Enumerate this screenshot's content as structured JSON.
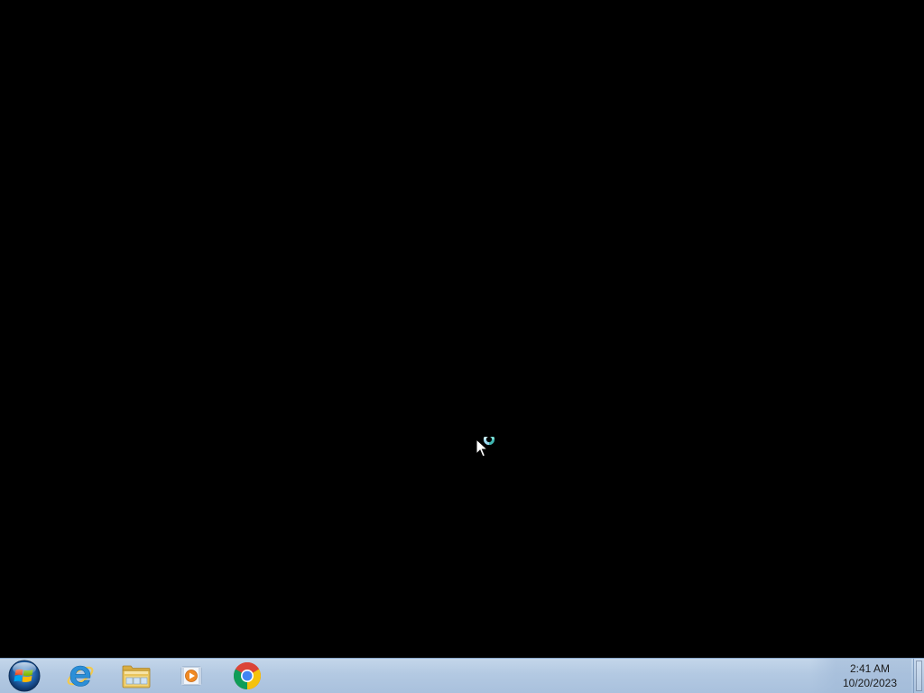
{
  "desktop": {
    "background": "#000000",
    "cursor_state": "busy-pointer"
  },
  "taskbar": {
    "background": "#b3c9e2",
    "start_button": {
      "icon": "windows-logo-icon"
    },
    "pinned": [
      {
        "name": "Internet Explorer",
        "icon": "internet-explorer-icon"
      },
      {
        "name": "Windows Explorer",
        "icon": "folder-explorer-icon"
      },
      {
        "name": "Windows Media Player",
        "icon": "media-player-icon"
      },
      {
        "name": "Google Chrome",
        "icon": "chrome-icon"
      }
    ],
    "tray": {
      "time": "2:41 AM",
      "date": "10/20/2023"
    }
  }
}
